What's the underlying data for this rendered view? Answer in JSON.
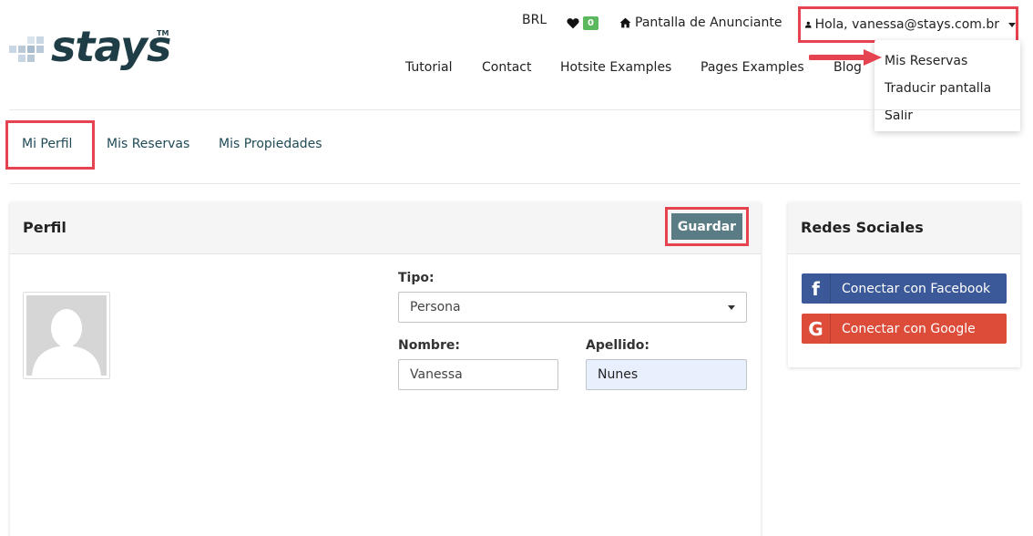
{
  "brand": {
    "name": "stays",
    "tm": "TM"
  },
  "topbar": {
    "currency": "BRL",
    "favorites_count": "0",
    "advertiser_link": "Pantalla de Anunciante",
    "user_greeting": "Hola, vanessa@stays.com.br"
  },
  "mainnav": [
    "Tutorial",
    "Contact",
    "Hotsite Examples",
    "Pages Examples",
    "Blog"
  ],
  "user_dropdown": [
    "Mis Reservas",
    "Traducir pantalla",
    "Salir"
  ],
  "tabs": [
    "Mi Perfil",
    "Mis Reservas",
    "Mis Propiedades"
  ],
  "profile": {
    "title": "Perfil",
    "save_label": "Guardar",
    "tipo_label": "Tipo:",
    "tipo_value": "Persona",
    "nombre_label": "Nombre:",
    "nombre_value": "Vanessa",
    "apellido_label": "Apellido:",
    "apellido_value": "Nunes"
  },
  "social": {
    "title": "Redes Sociales",
    "facebook_label": "Conectar con Facebook",
    "google_label": "Conectar con Google"
  },
  "colors": {
    "highlight": "#e5434f",
    "brand": "#1f3d46",
    "save_button": "#5a7d85",
    "facebook": "#3b5998",
    "google": "#dd4b39",
    "badge": "#5cb85c"
  },
  "icons": [
    "heart-icon",
    "home-icon",
    "user-icon",
    "facebook-icon",
    "google-icon"
  ]
}
